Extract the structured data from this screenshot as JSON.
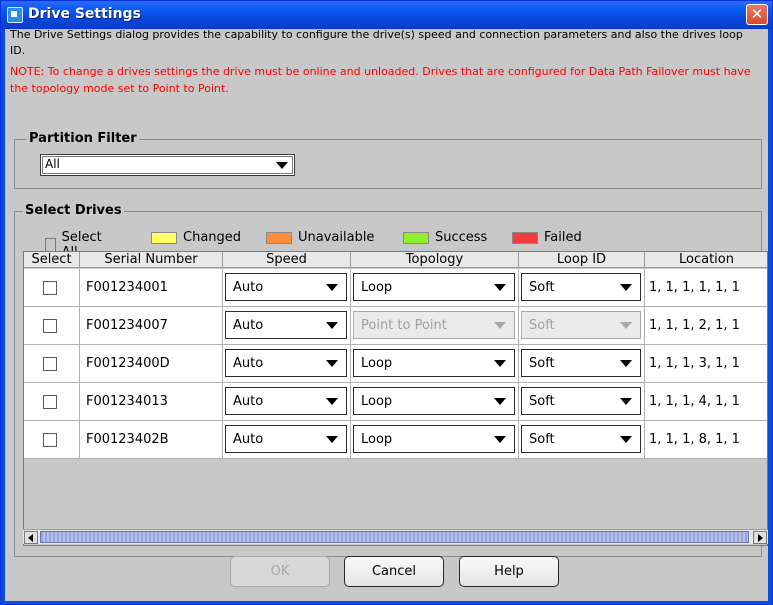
{
  "window": {
    "title": "Drive Settings",
    "close_glyph": "✕"
  },
  "description": "The Drive Settings dialog provides the capability to configure the drive(s) speed and connection parameters and also the drives loop ID.",
  "note": "NOTE: To change a drives settings the drive must be online and unloaded. Drives that are configured for Data Path Failover must have the topology mode set to Point to Point.",
  "partition_filter": {
    "label": "Partition Filter",
    "selected": "All"
  },
  "select_drives": {
    "label": "Select Drives",
    "legend": {
      "select_all": "Select All",
      "changed": "Changed",
      "unavailable": "Unavailable",
      "success": "Success",
      "failed": "Failed"
    },
    "colors": {
      "changed": "#ffff66",
      "unavailable": "#ff8c3a",
      "success": "#8ef22a",
      "failed": "#f03c3c"
    },
    "columns": [
      "Select",
      "Serial Number",
      "Speed",
      "Topology",
      "Loop ID",
      "Location"
    ],
    "rows": [
      {
        "serial": "F001234001",
        "speed": "Auto",
        "topology": "Loop",
        "loop_id": "Soft",
        "location": "1, 1, 1, 1, 1, 1"
      },
      {
        "serial": "F001234007",
        "speed": "Auto",
        "topology": "Point to Point",
        "loop_id": "Soft",
        "location": "1, 1, 1, 2, 1, 1"
      },
      {
        "serial": "F00123400D",
        "speed": "Auto",
        "topology": "Loop",
        "loop_id": "Soft",
        "location": "1, 1, 1, 3, 1, 1"
      },
      {
        "serial": "F001234013",
        "speed": "Auto",
        "topology": "Loop",
        "loop_id": "Soft",
        "location": "1, 1, 1, 4, 1, 1"
      },
      {
        "serial": "F00123402B",
        "speed": "Auto",
        "topology": "Loop",
        "loop_id": "Soft",
        "location": "1, 1, 1, 8, 1, 1"
      }
    ]
  },
  "buttons": {
    "ok": "OK",
    "cancel": "Cancel",
    "help": "Help"
  }
}
